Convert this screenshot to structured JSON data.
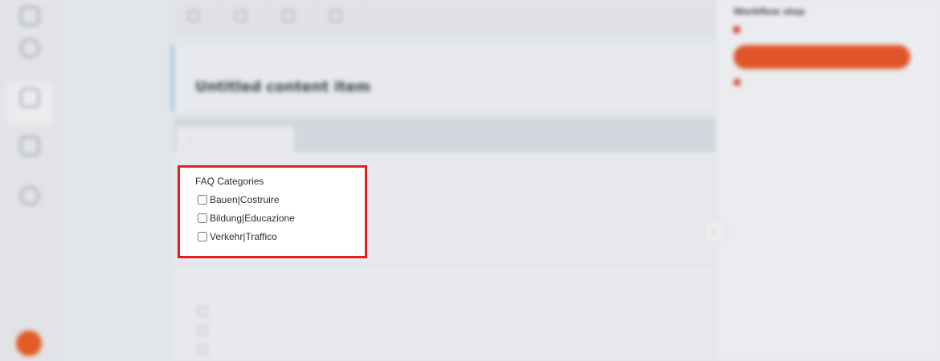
{
  "sidebar": {
    "items": [
      {
        "label": "",
        "icon": "home-icon"
      },
      {
        "label": "",
        "icon": "globe-icon"
      },
      {
        "label": "",
        "icon": "content-icon"
      },
      {
        "label": "",
        "icon": "folder-icon"
      },
      {
        "label": "",
        "icon": "settings-icon"
      }
    ],
    "fab_icon": "help-icon"
  },
  "toolbar": {
    "buttons": [
      {
        "label": "",
        "icon": "add-icon"
      },
      {
        "label": "",
        "icon": "workflow-icon"
      },
      {
        "label": "",
        "icon": "filter-icon"
      },
      {
        "label": "",
        "icon": "calendar-icon"
      }
    ]
  },
  "header": {
    "breadcrumb": "",
    "title": "Untitled content item"
  },
  "tabs": [
    {
      "label": ""
    }
  ],
  "faq": {
    "title": "FAQ Categories",
    "options": [
      {
        "label": "Bauen|Costruire",
        "checked": false
      },
      {
        "label": "Bildung|Educazione",
        "checked": false
      },
      {
        "label": "Verkehr|Traffico",
        "checked": false
      }
    ]
  },
  "secondary_field": {
    "label": "",
    "options": [
      {
        "label": ""
      },
      {
        "label": ""
      },
      {
        "label": ""
      }
    ]
  },
  "right_panel": {
    "workflow_label": "Workflow step",
    "workflow_state": "",
    "primary_button": "",
    "warning": "",
    "sections": [
      {
        "label": "",
        "value": ""
      },
      {
        "label": "",
        "value": ""
      },
      {
        "label": "",
        "value": ""
      },
      {
        "label": "",
        "value": ""
      },
      {
        "label": "",
        "value": ""
      }
    ]
  },
  "colors": {
    "accent": "#e65423",
    "highlight_border": "#e0201f"
  }
}
